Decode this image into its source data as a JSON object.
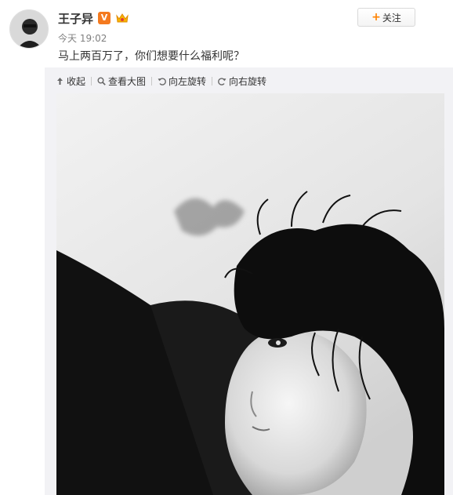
{
  "post": {
    "author": "王子异",
    "verified_badge": "V",
    "time": "今天 19:02",
    "text": "马上两百万了，你们想要什么福利呢？"
  },
  "actions": {
    "follow_label": "关注",
    "follow_icon": "plus-icon"
  },
  "media_toolbar": [
    {
      "label": "收起",
      "icon": "collapse-up-icon"
    },
    {
      "label": "查看大图",
      "icon": "magnify-icon"
    },
    {
      "label": "向左旋转",
      "icon": "rotate-left-icon"
    },
    {
      "label": "向右旋转",
      "icon": "rotate-right-icon"
    }
  ],
  "colors": {
    "accent": "#ff8200",
    "verified": "#f47a1f",
    "panel_bg": "#f2f2f5"
  }
}
